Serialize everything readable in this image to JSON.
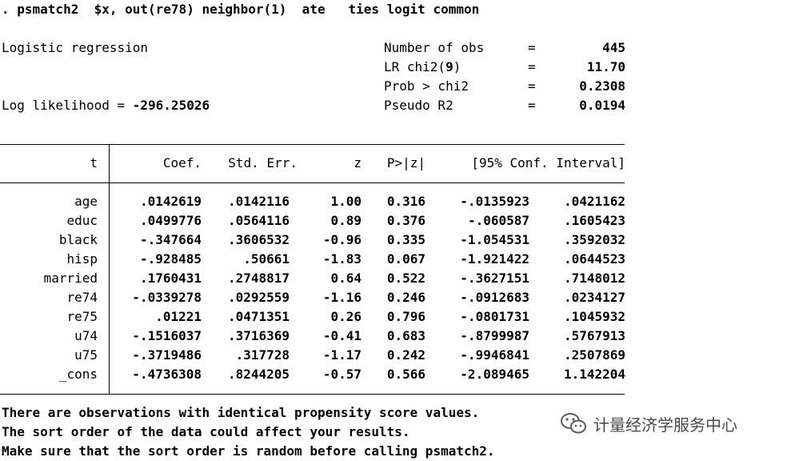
{
  "command": ". psmatch2  $x, out(re78) neighbor(1)  ate   ties logit common",
  "header": {
    "model_title": "Logistic regression",
    "log_likelihood_label": "Log likelihood = ",
    "log_likelihood_value": "-296.25026",
    "stats": [
      {
        "label": "Number of obs",
        "eq": "=",
        "value": "445"
      },
      {
        "label": "LR chi2(",
        "label_bold": "9",
        "label_tail": ")",
        "eq": "=",
        "value": "11.70"
      },
      {
        "label": "Prob > chi2",
        "eq": "=",
        "value": "0.2308"
      },
      {
        "label": "Pseudo R2",
        "eq": "=",
        "value": "0.0194"
      }
    ]
  },
  "table": {
    "dep_var": "t",
    "columns": [
      "Coef.",
      "Std. Err.",
      "z",
      "P>|z|",
      "[95% Conf. Interval]"
    ],
    "rows": [
      {
        "var": "age",
        "coef": ".0142619",
        "se": ".0142116",
        "z": "1.00",
        "p": "0.316",
        "lo": "-.0135923",
        "hi": ".0421162"
      },
      {
        "var": "educ",
        "coef": ".0499776",
        "se": ".0564116",
        "z": "0.89",
        "p": "0.376",
        "lo": "-.060587",
        "hi": ".1605423"
      },
      {
        "var": "black",
        "coef": "-.347664",
        "se": ".3606532",
        "z": "-0.96",
        "p": "0.335",
        "lo": "-1.054531",
        "hi": ".3592032"
      },
      {
        "var": "hisp",
        "coef": "-.928485",
        "se": ".50661",
        "z": "-1.83",
        "p": "0.067",
        "lo": "-1.921422",
        "hi": ".0644523"
      },
      {
        "var": "married",
        "coef": ".1760431",
        "se": ".2748817",
        "z": "0.64",
        "p": "0.522",
        "lo": "-.3627151",
        "hi": ".7148012"
      },
      {
        "var": "re74",
        "coef": "-.0339278",
        "se": ".0292559",
        "z": "-1.16",
        "p": "0.246",
        "lo": "-.0912683",
        "hi": ".0234127"
      },
      {
        "var": "re75",
        "coef": ".01221",
        "se": ".0471351",
        "z": "0.26",
        "p": "0.796",
        "lo": "-.0801731",
        "hi": ".1045932"
      },
      {
        "var": "u74",
        "coef": "-.1516037",
        "se": ".3716369",
        "z": "-0.41",
        "p": "0.683",
        "lo": "-.8799987",
        "hi": ".5767913"
      },
      {
        "var": "u75",
        "coef": "-.3719486",
        "se": ".317728",
        "z": "-1.17",
        "p": "0.242",
        "lo": "-.9946841",
        "hi": ".2507869"
      },
      {
        "var": "_cons",
        "coef": "-.4736308",
        "se": ".8244205",
        "z": "-0.57",
        "p": "0.566",
        "lo": "-2.089465",
        "hi": "1.142204"
      }
    ]
  },
  "messages": [
    "There are observations with identical propensity score values.",
    "The sort order of the data could affect your results.",
    "Make sure that the sort order is random before calling psmatch2."
  ],
  "watermark": {
    "icon": "wechat-icon",
    "text": "计量经济学服务中心",
    "color": "#4a4a4a"
  }
}
